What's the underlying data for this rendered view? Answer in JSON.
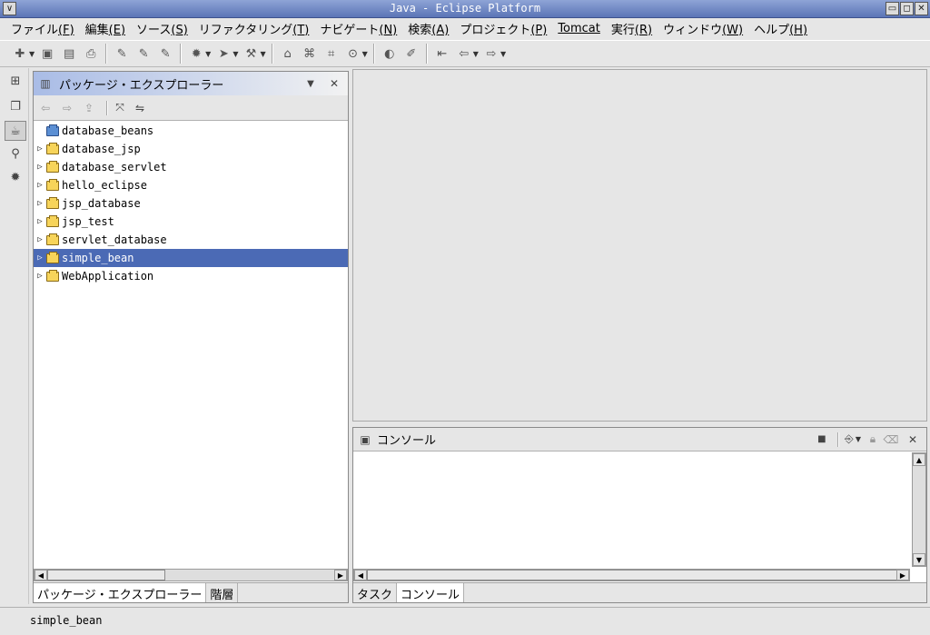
{
  "window": {
    "title": "Java - Eclipse Platform",
    "controls": {
      "menu": "∨",
      "minimize": "▭",
      "maximize": "◻",
      "close": "✕"
    }
  },
  "menubar": {
    "items": [
      {
        "label": "ファイル",
        "mnemonic": "(F)"
      },
      {
        "label": "編集",
        "mnemonic": "(E)"
      },
      {
        "label": "ソース",
        "mnemonic": "(S)"
      },
      {
        "label": "リファクタリング",
        "mnemonic": "(T)"
      },
      {
        "label": "ナビゲート",
        "mnemonic": "(N)"
      },
      {
        "label": "検索",
        "mnemonic": "(A)"
      },
      {
        "label": "プロジェクト",
        "mnemonic": "(P)"
      },
      {
        "label": "Tomcat",
        "mnemonic": ""
      },
      {
        "label": "実行",
        "mnemonic": "(R)"
      },
      {
        "label": "ウィンドウ",
        "mnemonic": "(W)"
      },
      {
        "label": "ヘルプ",
        "mnemonic": "(H)"
      }
    ]
  },
  "toolbar": {
    "icons": [
      "new-wizard-icon",
      "save-icon",
      "save-all-icon",
      "print-icon",
      "new-java-project-icon",
      "new-package-icon",
      "new-class-icon",
      "debug-icon",
      "run-icon",
      "external-tools-icon",
      "open-type-icon",
      "open-type-hierarchy-icon",
      "search-icon",
      "open-perspective-icon",
      "pin-icon",
      "last-edit-icon",
      "back-icon",
      "forward-icon"
    ]
  },
  "perspectives": {
    "icons": [
      "open-perspective-icon",
      "resource-perspective-icon",
      "java-perspective-icon",
      "java-browsing-perspective-icon",
      "debug-perspective-icon"
    ]
  },
  "package_explorer": {
    "title": "パッケージ・エクスプローラー",
    "view_menu": "▼",
    "close": "✕",
    "projects": [
      {
        "name": "database_beans",
        "expandable": false,
        "selected": false
      },
      {
        "name": "database_jsp",
        "expandable": true,
        "selected": false
      },
      {
        "name": "database_servlet",
        "expandable": true,
        "selected": false
      },
      {
        "name": "hello_eclipse",
        "expandable": true,
        "selected": false
      },
      {
        "name": "jsp_database",
        "expandable": true,
        "selected": false
      },
      {
        "name": "jsp_test",
        "expandable": true,
        "selected": false
      },
      {
        "name": "servlet_database",
        "expandable": true,
        "selected": false
      },
      {
        "name": "simple_bean",
        "expandable": true,
        "selected": true
      },
      {
        "name": "WebApplication",
        "expandable": true,
        "selected": false
      }
    ],
    "tabs": [
      "パッケージ・エクスプローラー",
      "階層"
    ]
  },
  "console": {
    "title": "コンソール",
    "close": "✕",
    "tabs": [
      "タスク",
      "コンソール"
    ]
  },
  "status": {
    "text": "simple_bean"
  }
}
